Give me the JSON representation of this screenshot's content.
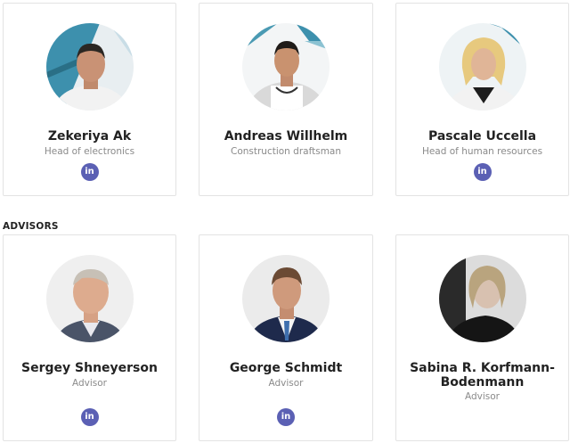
{
  "team": [
    {
      "name": "Zekeriya Ak",
      "role": "Head of electronics",
      "social": "in"
    },
    {
      "name": "Andreas Willhelm",
      "role": "Construction draftsman",
      "social": "in"
    },
    {
      "name": "Pascale Uccella",
      "role": "Head of human resources",
      "social": "in"
    }
  ],
  "advisors_heading": "ADVISORS",
  "advisors": [
    {
      "name": "Sergey Shneyerson",
      "role": "Advisor",
      "social": "in"
    },
    {
      "name": "George Schmidt",
      "role": "Advisor",
      "social": "in"
    },
    {
      "name": "Sabina R. Korfmann-Bodenmann",
      "role": "Advisor",
      "social": "in"
    }
  ],
  "colors": {
    "linkedin": "#5b60b4",
    "name": "#222222",
    "role": "#8a8a8a",
    "border": "#e3e3e3"
  },
  "icons": {
    "social": "linkedin-icon"
  }
}
